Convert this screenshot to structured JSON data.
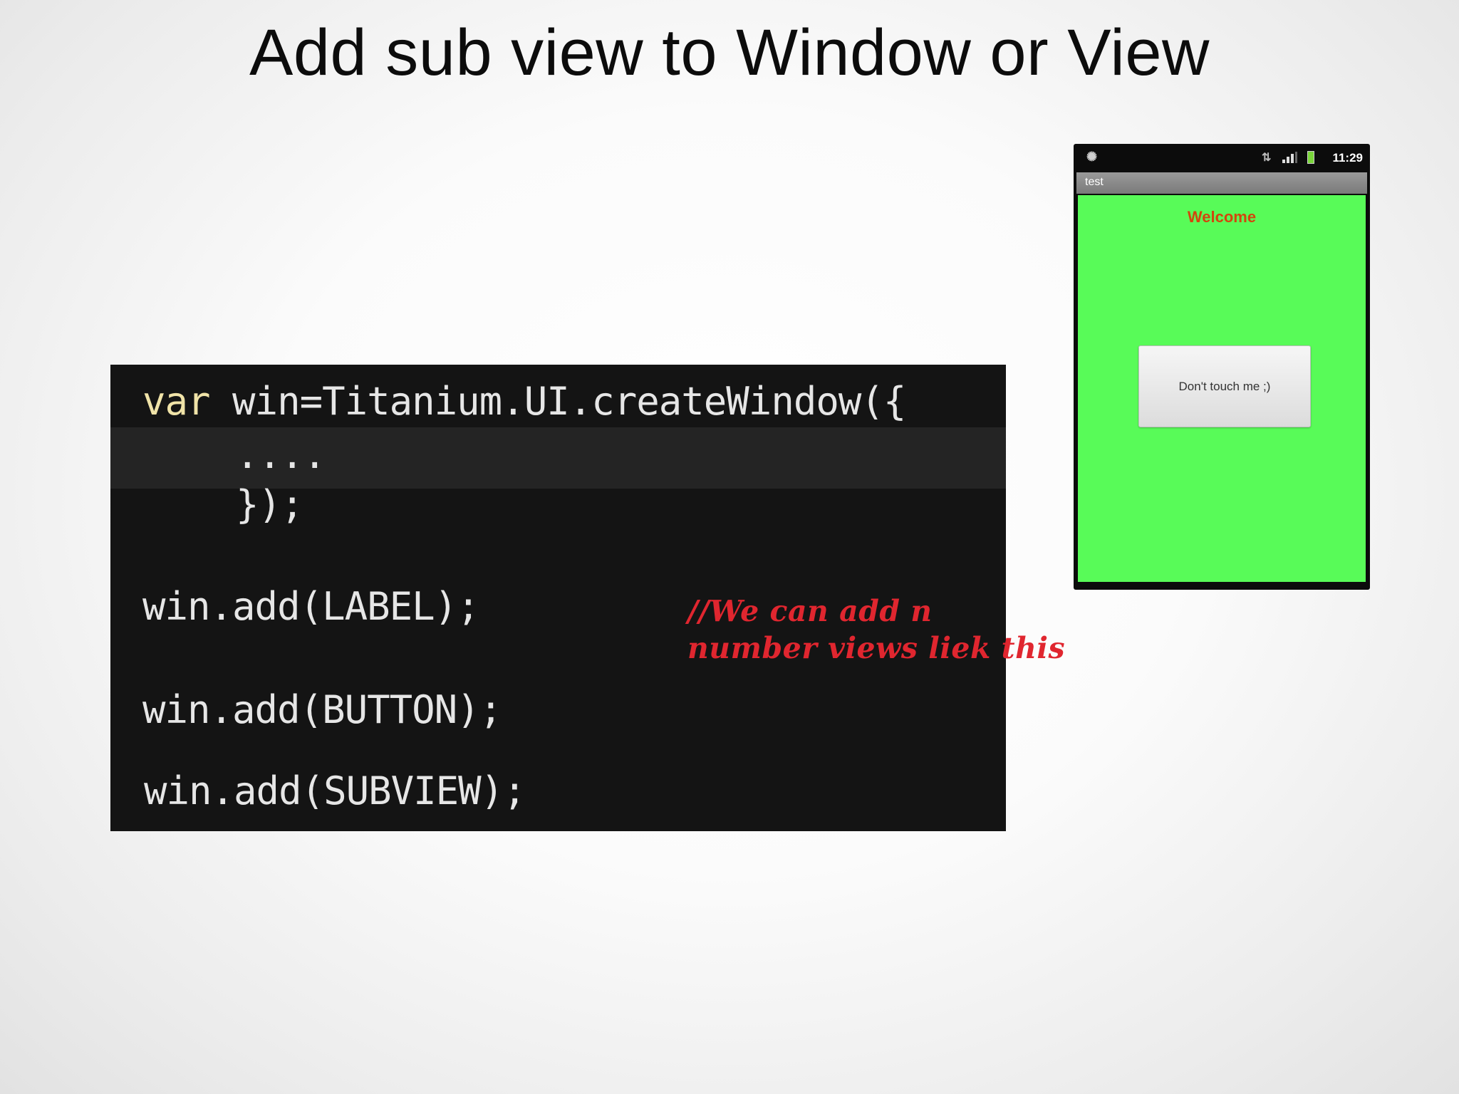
{
  "slide": {
    "title": "Add sub view to Window or View"
  },
  "code": {
    "line1_kw": "var",
    "line1_rest": " win=Titanium.UI.createWindow({",
    "line2": "....",
    "line3": "});",
    "line4": "win.add(LABEL);",
    "line5": "win.add(BUTTON);",
    "line6": "win.add(SUBVIEW);",
    "comment": "//We can add n\nnumber views liek this"
  },
  "phone": {
    "status_time": "11:29",
    "app_title": "test",
    "welcome_label": "Welcome",
    "button_label": "Don't touch me ;)",
    "icons": {
      "notification": "notification-icon",
      "usb": "usb-icon",
      "signal": "signal-icon",
      "battery": "battery-icon"
    }
  },
  "colors": {
    "code_background": "#141414",
    "comment": "#e0262f",
    "app_background": "#58fb58",
    "welcome": "#d2460d"
  }
}
